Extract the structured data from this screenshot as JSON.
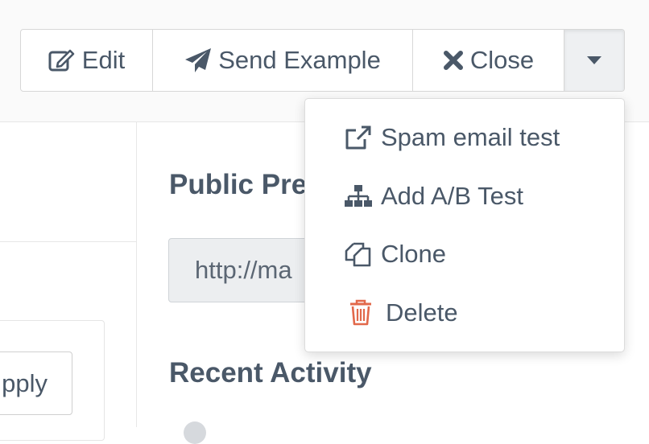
{
  "toolbar": {
    "edit_label": "Edit",
    "send_example_label": "Send Example",
    "close_label": "Close"
  },
  "dropdown": {
    "items": [
      {
        "label": "Spam email test",
        "icon": "external-link-icon"
      },
      {
        "label": "Add A/B Test",
        "icon": "sitemap-icon"
      },
      {
        "label": "Clone",
        "icon": "clone-icon"
      },
      {
        "label": "Delete",
        "icon": "trash-icon"
      }
    ]
  },
  "main": {
    "public_preview_title": "Public Pre",
    "public_preview_url": "http://ma",
    "recent_activity_title": "Recent Activity"
  },
  "left": {
    "apply_label": "pply"
  },
  "colors": {
    "text": "#4a5868",
    "delete_icon": "#e2694b",
    "input_bg": "#eceef0",
    "topbar_bg": "#fafafa"
  }
}
